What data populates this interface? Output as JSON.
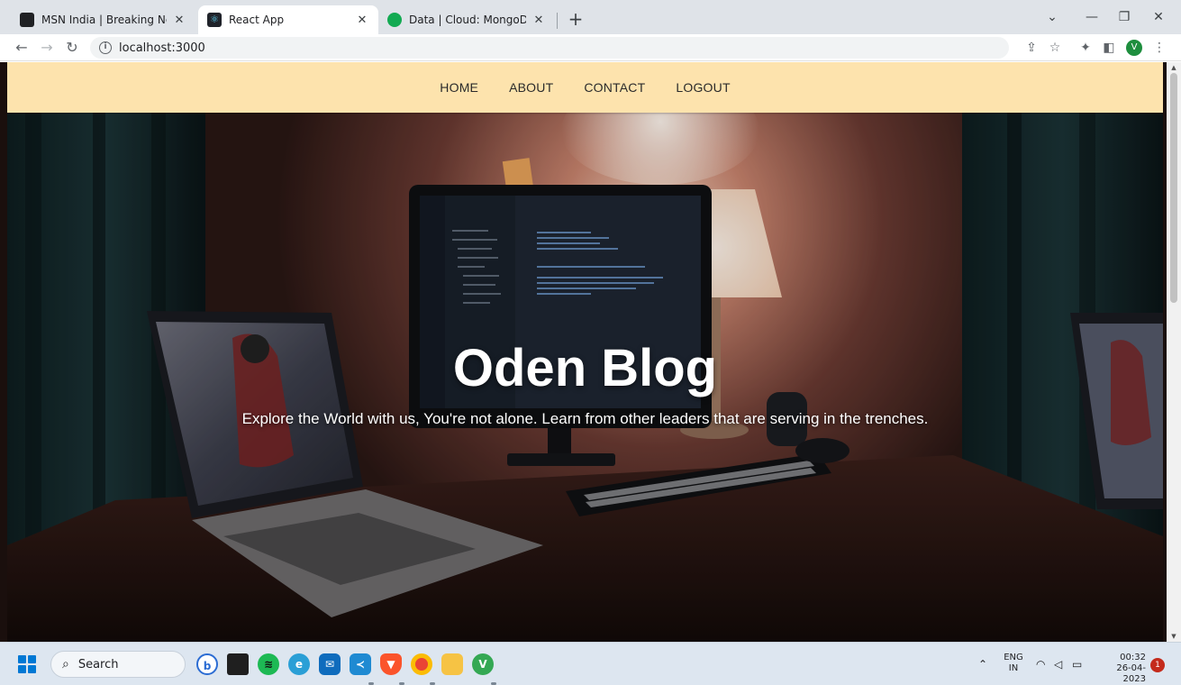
{
  "browser": {
    "tabs": [
      {
        "title": "MSN India | Breaking News, Ente",
        "favicon": "msn-icon",
        "active": false
      },
      {
        "title": "React App",
        "favicon": "react-icon",
        "active": true
      },
      {
        "title": "Data | Cloud: MongoDB Cloud",
        "favicon": "mongodb-icon",
        "active": false
      }
    ],
    "url": "localhost:3000"
  },
  "site": {
    "nav": [
      "HOME",
      "ABOUT",
      "CONTACT",
      "LOGOUT"
    ],
    "hero": {
      "title": "Oden Blog",
      "subtitle": "Explore the World with us, You're not alone. Learn from other leaders that are serving in the trenches."
    }
  },
  "taskbar": {
    "search_label": "Search",
    "apps": [
      "bing-icon",
      "terminal-icon",
      "spotify-icon",
      "edge-icon",
      "mail-icon",
      "vscode-icon",
      "brave-icon",
      "chrome-icon",
      "file-explorer-icon",
      "chrome-profile-icon"
    ],
    "lang_top": "ENG",
    "lang_bottom": "IN",
    "time": "00:32",
    "date": "26-04-2023",
    "notification_count": "1"
  },
  "colors": {
    "nav_bg": "#fde3ad",
    "taskbar_bg": "#dde6f0",
    "accent": "#0078d4"
  }
}
